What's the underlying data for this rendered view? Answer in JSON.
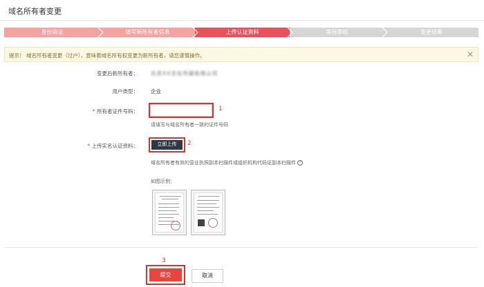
{
  "page": {
    "title": "域名所有者变更"
  },
  "steps": [
    {
      "label": "身份验证",
      "state": "done"
    },
    {
      "label": "填写新所有者信息",
      "state": "done"
    },
    {
      "label": "上传认证资料",
      "state": "active"
    },
    {
      "label": "等待审核",
      "state": "pending"
    },
    {
      "label": "变更结果",
      "state": "pending"
    }
  ],
  "colors": {
    "step_done": "#f3a3a0",
    "step_active": "#e8525a",
    "step_pending": "#d6d6d6",
    "accent": "#d9332c"
  },
  "notice": {
    "text": "提示！   域名所有者变更（过户），意味着域名所有权变更为新所有者，请您谨慎操作。",
    "close_icon": "close-icon"
  },
  "form": {
    "new_owner_label": "变更后新所有者：",
    "new_owner_value": "北京XX文化传媒有限公司",
    "user_type_label": "用户类型：",
    "user_type_value": "企业",
    "cert_no_label": "所有者证件号码：",
    "cert_no_value": "",
    "cert_no_hint": "请填写与域名所有者一致的证件号码",
    "upload_label": "上传实名认证资料：",
    "upload_button": "立即上传",
    "upload_desc": "域名所有者有效的营业执照副本扫描件或组织机构代码证副本扫描件",
    "example_label": "如图示例：",
    "required_mark": "*"
  },
  "annotations": {
    "n1": "1",
    "n2": "2",
    "n3": "3"
  },
  "actions": {
    "submit": "提交",
    "cancel": "取消"
  }
}
